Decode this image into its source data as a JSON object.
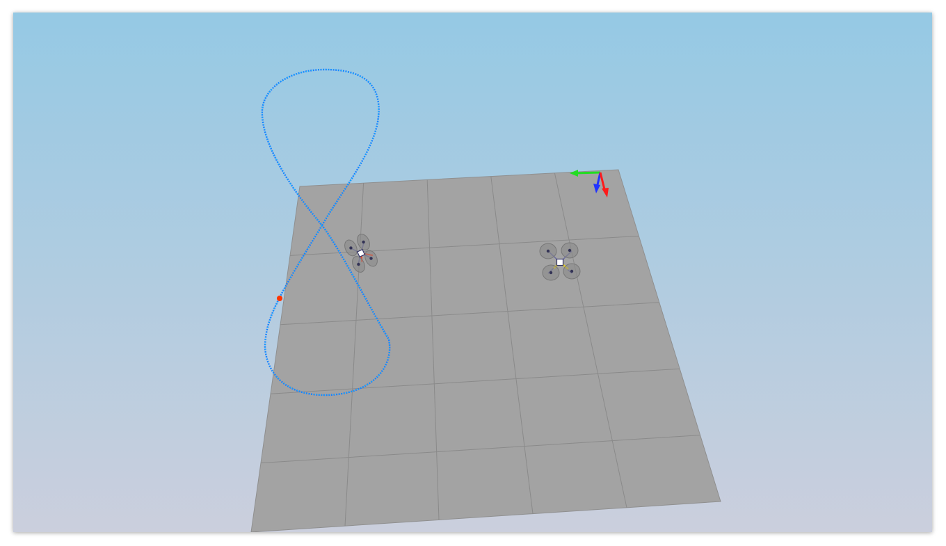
{
  "scene": {
    "sky_top_color": "#95c9e4",
    "sky_bottom_color": "#cbcfdd",
    "ground_color": "#a3a3a3",
    "grid_line_color": "#8a8a8a",
    "trajectory_color": "#1e6fff",
    "trajectory_inner_color": "#00d4ff",
    "current_position_color": "#ff3300"
  },
  "axis_gizmo": {
    "x_axis_color": "#ff1a1a",
    "y_axis_color": "#22dd22",
    "z_axis_color": "#2222ff"
  },
  "vehicles": [
    {
      "name": "quadrotor",
      "arm_color": "#ff4422",
      "rotor_color": "#888888"
    },
    {
      "name": "quadrotor",
      "arm_color": "#e8d020",
      "rotor_color": "#888888"
    }
  ]
}
